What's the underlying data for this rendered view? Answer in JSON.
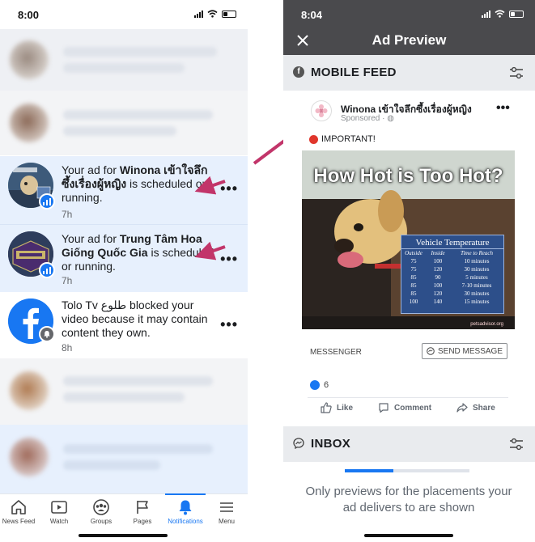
{
  "left_phone": {
    "status_time": "8:00",
    "notifications": [
      {
        "prefix": "Your ad for ",
        "bold": "Winona เข้าใจลึกซึ้งเรื่องผู้หญิง",
        "suffix": " is scheduled or running.",
        "time": "7h"
      },
      {
        "prefix": "Your ad for ",
        "bold": "Trung Tâm Hoa Giống Quốc Gia",
        "suffix": " is scheduled or running.",
        "time": "7h"
      },
      {
        "prefix": "Tolo Tv طلوع blocked your video because it may contain content they own.",
        "bold": "",
        "suffix": "",
        "time": "8h"
      }
    ],
    "tabs": [
      {
        "label": "News Feed",
        "icon": "home-icon"
      },
      {
        "label": "Watch",
        "icon": "video-icon"
      },
      {
        "label": "Groups",
        "icon": "groups-icon"
      },
      {
        "label": "Pages",
        "icon": "flag-icon"
      },
      {
        "label": "Notifications",
        "icon": "bell-icon"
      },
      {
        "label": "Menu",
        "icon": "hamburger-icon"
      }
    ],
    "active_tab": "Notifications",
    "colors": {
      "unread_bg": "#e7f0fd",
      "accent": "#1877f2",
      "arrow": "#c2356a"
    }
  },
  "right_phone": {
    "status_time": "8:04",
    "title": "Ad Preview",
    "sections": {
      "mobile_feed": "MOBILE FEED",
      "inbox": "INBOX"
    },
    "ad": {
      "page_name": "Winona เข้าใจลึกซึ้งเรื่องผู้หญิง",
      "sponsored": "Sponsored",
      "important": "IMPORTANT!",
      "image": {
        "headline": "How Hot is Too Hot?",
        "table_title": "Vehicle Temperature",
        "columns": [
          "Outside",
          "Inside",
          "Time to Reach"
        ],
        "rows": [
          [
            "75",
            "100",
            "10 minutes"
          ],
          [
            "75",
            "120",
            "30 minutes"
          ],
          [
            "85",
            "90",
            "5 minutes"
          ],
          [
            "85",
            "100",
            "7-10 minutes"
          ],
          [
            "85",
            "120",
            "30 minutes"
          ],
          [
            "100",
            "140",
            "15 minutes"
          ]
        ],
        "credit": "petsadvisor.org"
      },
      "messenger_label": "MESSENGER",
      "send_button": "SEND MESSAGE",
      "like_count": "6",
      "actions": [
        "Like",
        "Comment",
        "Share"
      ]
    },
    "inbox_note": "Only previews for the placements your ad delivers to are shown",
    "colors": {
      "header_bg": "#4a4a4d",
      "section_bg": "#e9ebee"
    }
  }
}
